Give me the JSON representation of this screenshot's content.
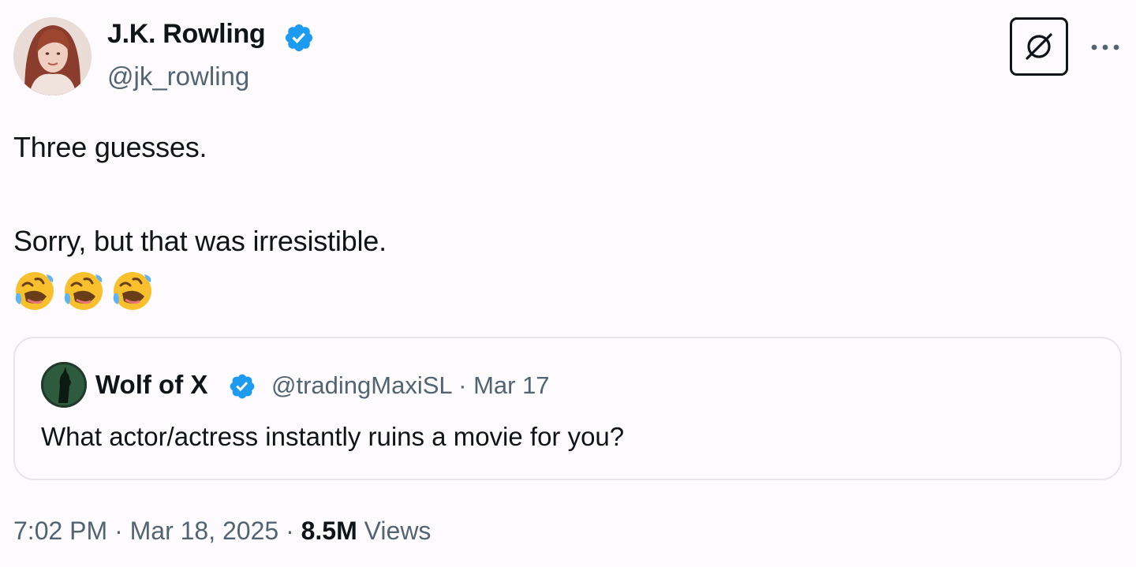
{
  "author": {
    "name": "J.K. Rowling",
    "handle": "@jk_rowling",
    "verified": true,
    "avatar_icon": "avatar-photo"
  },
  "tweet": {
    "lines": [
      "Three guesses.",
      "Sorry, but that was irresistible."
    ],
    "emojis": [
      "rolling-on-floor-laughing",
      "rolling-on-floor-laughing",
      "rolling-on-floor-laughing"
    ]
  },
  "quoted_tweet": {
    "name": "Wolf of X",
    "handle": "@tradingMaxiSL",
    "separator": "·",
    "date": "Mar 17",
    "text": "What actor/actress instantly ruins a movie for you?",
    "verified": true
  },
  "footer": {
    "time": "7:02 PM",
    "separator": "·",
    "date": "Mar 18, 2025",
    "views_count": "8.5M",
    "views_label": "Views"
  },
  "icons": {
    "grok": "grok-icon",
    "more": "more-icon",
    "verified": "verified-badge-icon"
  },
  "colors": {
    "background": "#fdfbfd",
    "text": "#0f1419",
    "secondary_text": "#536471",
    "verified": "#1d9bf0",
    "card_border": "#e8e4ea"
  }
}
